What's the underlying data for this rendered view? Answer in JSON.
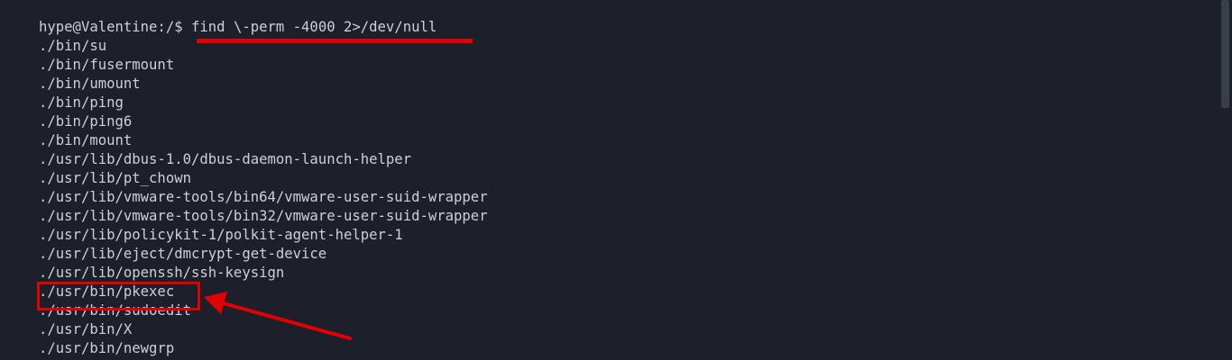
{
  "terminal": {
    "prompt": "hype@Valentine:/$ ",
    "command": "find \\-perm -4000 2>/dev/null",
    "output_lines": [
      "./bin/su",
      "./bin/fusermount",
      "./bin/umount",
      "./bin/ping",
      "./bin/ping6",
      "./bin/mount",
      "./usr/lib/dbus-1.0/dbus-daemon-launch-helper",
      "./usr/lib/pt_chown",
      "./usr/lib/vmware-tools/bin64/vmware-user-suid-wrapper",
      "./usr/lib/vmware-tools/bin32/vmware-user-suid-wrapper",
      "./usr/lib/policykit-1/polkit-agent-helper-1",
      "./usr/lib/eject/dmcrypt-get-device",
      "./usr/lib/openssh/ssh-keysign",
      "./usr/bin/pkexec",
      "./usr/bin/sudoedit",
      "./usr/bin/X",
      "./usr/bin/newgrp"
    ]
  },
  "annotations": {
    "color": "#e10000",
    "underline_target": "command",
    "highlighted_line": "./usr/bin/pkexec"
  },
  "colors": {
    "background": "#1d1f2b",
    "text": "#cdd0dc"
  }
}
